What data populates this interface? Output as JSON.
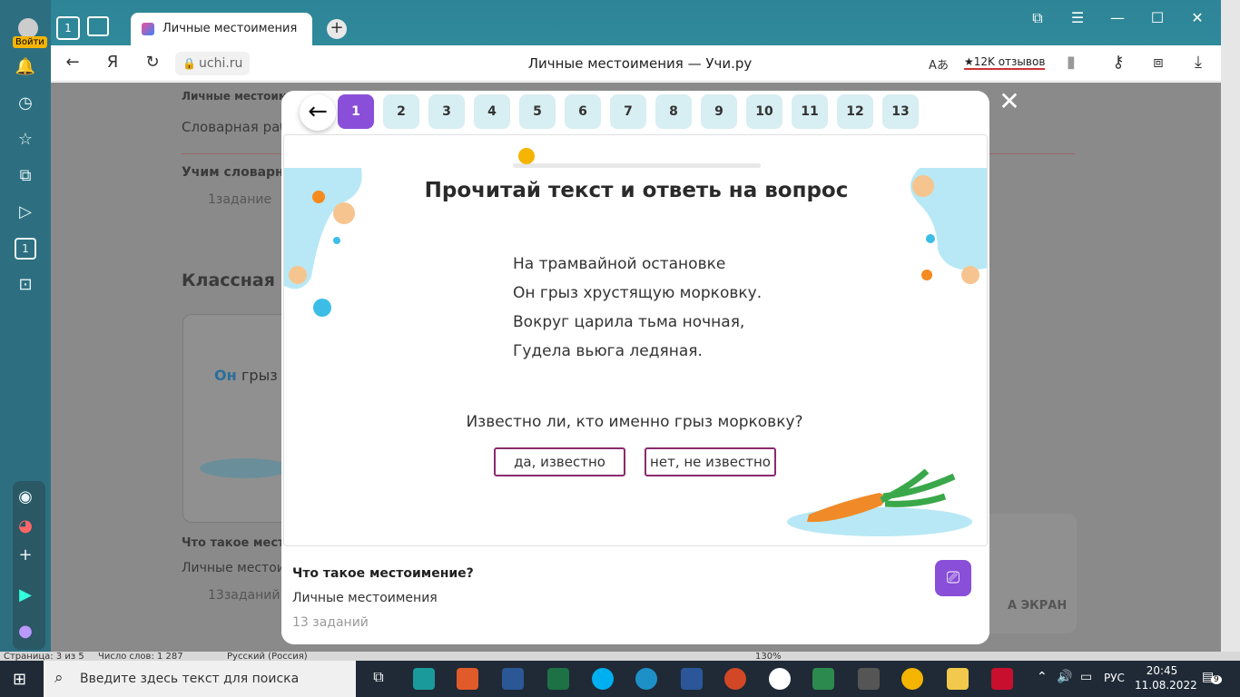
{
  "browser": {
    "tab_title": "Личные местоимения -",
    "url": "uchi.ru",
    "page_title": "Личные местоимения — Учи.ру",
    "reviews": "★12K отзывов",
    "login_label": "Войти"
  },
  "background_page": {
    "breadcrumb": "Личные местоиме",
    "section1": "Словарная раб",
    "subtitle": "Учим словарны",
    "tasks1": "1задание",
    "section2": "Классная р",
    "card_text_bold": "Он",
    "card_text": "грыз",
    "topic": "Что такое мест",
    "topic_sub": "Личные местои",
    "tasks2": "13заданий",
    "screen_btn": "А ЭКРАН"
  },
  "modal": {
    "question_numbers": [
      "1",
      "2",
      "3",
      "4",
      "5",
      "6",
      "7",
      "8",
      "9",
      "10",
      "11",
      "12",
      "13"
    ],
    "active_question": "1",
    "task_title": "Прочитай текст и ответь на вопрос",
    "poem": [
      "На трамвайной остановке",
      "Он грыз хрустящую морковку.",
      "Вокруг царила тьма ночная,",
      "Гудела вьюга ледяная."
    ],
    "question": "Известно ли, кто именно грыз морковку?",
    "answers": [
      "да, известно",
      "нет, не известно"
    ],
    "footer_title": "Что такое местоимение?",
    "footer_subtitle": "Личные местоимения",
    "footer_count": "13 заданий"
  },
  "word_status": {
    "page": "Страница: 3 из 5",
    "words": "Число слов: 1 287",
    "lang": "Русский (Россия)",
    "zoom": "130%"
  },
  "taskbar": {
    "search_placeholder": "Введите здесь текст для поиска",
    "lang": "РУС",
    "time": "20:45",
    "date": "11.08.2022",
    "notifications": "9"
  },
  "colors": {
    "accent": "#8a4fd8",
    "qnum_bg": "#d7eef2",
    "answer_border": "#8a2b6e",
    "browser_bar": "#2f8a9b"
  }
}
